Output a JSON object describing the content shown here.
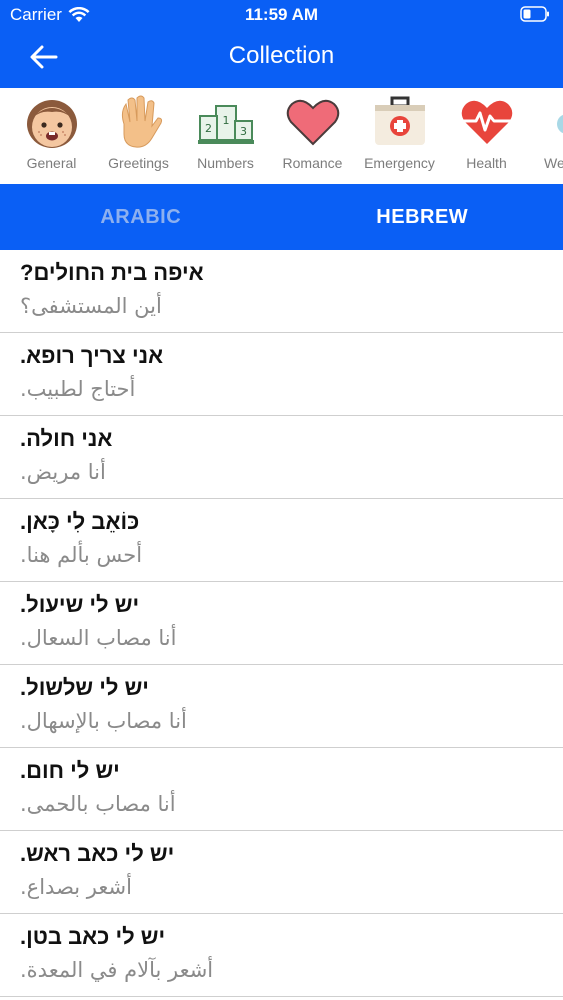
{
  "status_bar": {
    "carrier": "Carrier",
    "time": "11:59 AM"
  },
  "header": {
    "title": "Collection",
    "back_icon": "arrow-left-icon"
  },
  "categories": [
    {
      "label": "General",
      "icon": "girl-face-icon"
    },
    {
      "label": "Greetings",
      "icon": "waving-hand-icon"
    },
    {
      "label": "Numbers",
      "icon": "podium-icon"
    },
    {
      "label": "Romance",
      "icon": "heart-icon"
    },
    {
      "label": "Emergency",
      "icon": "first-aid-kit-icon"
    },
    {
      "label": "Health",
      "icon": "heartbeat-icon"
    },
    {
      "label": "We",
      "icon": "partial-category-icon"
    }
  ],
  "tabs": [
    {
      "label": "ARABIC",
      "active": false
    },
    {
      "label": "HEBREW",
      "active": true
    }
  ],
  "phrases": [
    {
      "primary": "איפה בית החולים?",
      "secondary": "أين المستشفى؟"
    },
    {
      "primary": "אני צריך רופא.",
      "secondary": "أحتاج لطبيب."
    },
    {
      "primary": "אני חולה.",
      "secondary": "أنا مريض."
    },
    {
      "primary": "כּוֹאֵב לִי כָּאן.",
      "secondary": "أحس بألم هنا."
    },
    {
      "primary": "יש לי שיעול.",
      "secondary": "أنا مصاب السعال."
    },
    {
      "primary": "יש לי שלשול.",
      "secondary": "أنا مصاب بالإسهال."
    },
    {
      "primary": "יש לי חום.",
      "secondary": "أنا مصاب بالحمى."
    },
    {
      "primary": "יש לי כאב ראש.",
      "secondary": "أشعر بصداع."
    },
    {
      "primary": "יש לי כאב בטן.",
      "secondary": "أشعر بآلام في المعدة."
    }
  ],
  "colors": {
    "primary_blue": "#0a5ff5",
    "inactive_tab": "#8db0ef",
    "label_gray": "#7c7c7c"
  }
}
